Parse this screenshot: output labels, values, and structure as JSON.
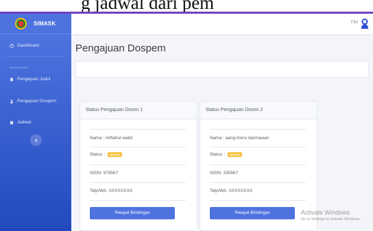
{
  "caption": "g jadwal dari pem",
  "app": {
    "brand": "SIMASK"
  },
  "sidebar": {
    "items": [
      {
        "label": "Dashboard"
      },
      {
        "label": "Pengajuan Judul"
      },
      {
        "label": "Pengajuan Dospem"
      },
      {
        "label": "Jadwal"
      }
    ],
    "heading": "MAHASISWA"
  },
  "topbar": {
    "user": "Fitri"
  },
  "page": {
    "title": "Pengajuan Dospem"
  },
  "cards": [
    {
      "title": "Status Pengajuan Dosen 1",
      "nama": "Nama : miftahul walid",
      "status_label": "Status :",
      "status_badge": "diterima",
      "nidn": "NIDN: 978567",
      "telp": "Telp/WA: XXXXXXXX",
      "button": "Riwayat Bimbingan"
    },
    {
      "title": "Status Pengajuan Dosen 2",
      "nama": "Nama : aang kisnu darmawan",
      "status_label": "Status :",
      "status_badge": "diterima",
      "nidn": "NIDN: 335667",
      "telp": "Telp/WA: XXXXXXXX",
      "button": "Riwayat Bimbingan"
    }
  ],
  "watermark": {
    "line1": "Activate Windows",
    "line2": "Go to Settings to activate Windows."
  },
  "colors": {
    "primary": "#4e73df",
    "warning": "#f6c23e"
  }
}
